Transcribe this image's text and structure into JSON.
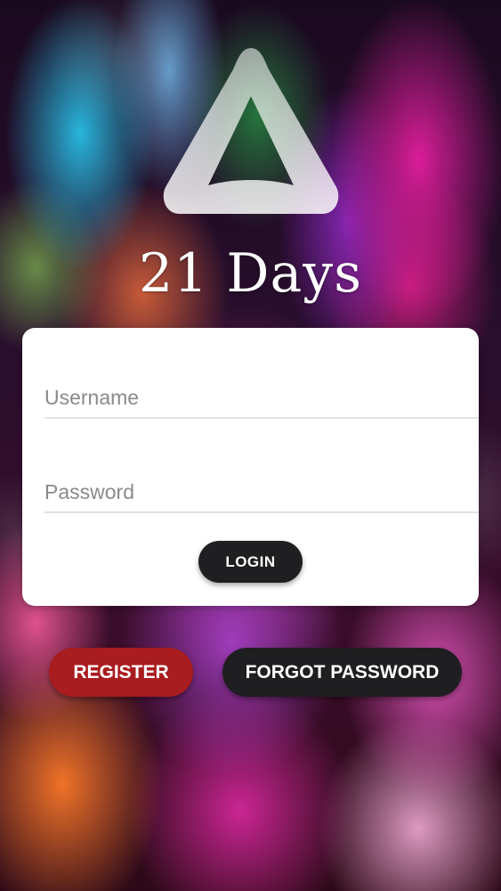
{
  "brand": {
    "logo": "triangle-logo-icon",
    "title": "21 Days"
  },
  "login_form": {
    "username": {
      "placeholder": "Username",
      "value": ""
    },
    "password": {
      "placeholder": "Password",
      "value": ""
    },
    "login_label": "LOGIN"
  },
  "actions": {
    "register_label": "REGISTER",
    "forgot_password_label": "FORGOT PASSWORD"
  },
  "colors": {
    "register_button": "#a91c1f",
    "dark_button": "#1f1e20",
    "card_background": "#ffffff"
  }
}
